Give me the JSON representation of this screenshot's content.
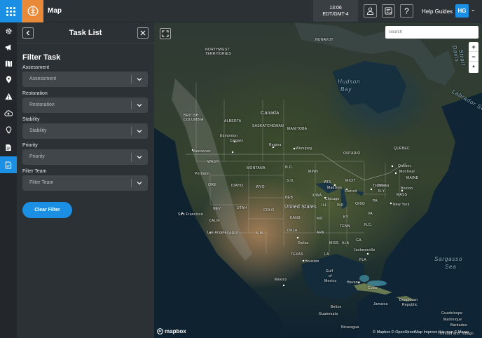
{
  "header": {
    "app_title": "Map",
    "clock_time": "13:06",
    "clock_zone": "EDT/GMT-4",
    "help_label": "Help Guides",
    "avatar_initials": "HG"
  },
  "rail": {
    "icons": [
      "gear-icon",
      "megaphone-icon",
      "map-icon",
      "pin-icon",
      "warning-icon",
      "cloud-upload-icon",
      "bulb-icon",
      "document-icon",
      "task-list-icon"
    ],
    "active_index": 8
  },
  "panel": {
    "title": "Task List",
    "filter_heading": "Filter Task",
    "filters": [
      {
        "label": "Assessment",
        "value": "Assessment"
      },
      {
        "label": "Restoration",
        "value": "Restoration"
      },
      {
        "label": "Stability",
        "value": "Stability"
      },
      {
        "label": "Priority",
        "value": "Priority"
      },
      {
        "label": "Filter Team",
        "value": "Filter Team"
      }
    ],
    "clear_label": "Clear Filter"
  },
  "map": {
    "search_placeholder": "Search",
    "zoom_in": "+",
    "zoom_out": "−",
    "reset_north": "▲",
    "logo_text": "mapbox",
    "attribution": "© Mapbox © OpenStreetMap Improve this map © Maxar",
    "labels": {
      "nwt": "NORTHWEST",
      "nwt2": "TERRITORIES",
      "nunavut": "NUNAVUT",
      "hudson1": "Hudson",
      "hudson2": "Bay",
      "davis1": "Davis",
      "davis2": "Strait",
      "labrador": "Labrador Sea",
      "canada": "Canada",
      "bc1": "BRITISH",
      "bc2": "COLUMBIA",
      "alberta": "ALBERTA",
      "sask": "SASKATCHEWAN",
      "manitoba": "MANITOBA",
      "ontario": "ONTARIO",
      "quebec": "QUÉBEC",
      "edmonton": "Edmonton",
      "calgary": "Calgary",
      "regina": "Regina",
      "winnipeg": "Winnipeg",
      "vancouver": "Vancouver",
      "ottawa": "Ottawa",
      "quebec_city": "Québec",
      "montreal": "Montreal",
      "wash": "WASH",
      "montana": "MONTANA",
      "ore": "ORE",
      "idaho": "IDAHO",
      "nd": "N.D.",
      "sd": "S.D.",
      "minn": "MINN",
      "wis": "WIS",
      "mich": "MICH",
      "maine": "MAINE",
      "portland": "Portland",
      "wyo": "WYO",
      "neb": "NEB",
      "iowa": "IOWA",
      "madison": "Madison",
      "detroit": "Detroit",
      "toronto": "Toronto",
      "ny": "N.Y.",
      "boston": "Boston",
      "mass": "MASS",
      "nev": "NEV",
      "utah": "UTAH",
      "colo": "COLO",
      "ill": "ILL",
      "ind": "IND",
      "ohio": "OHIO",
      "pa": "PA",
      "chicago": "Chicago",
      "newyork": "New York",
      "sanfrancisco": "San Francisco",
      "calif": "CALIF",
      "unitedstates": "United States",
      "kans": "KANS",
      "mo": "MO",
      "ky": "KY",
      "va": "VA",
      "losangeles": "Los Angeles",
      "ariz": "ARIZ",
      "nm": "N.M.",
      "okla": "OKLA",
      "ark": "ARK",
      "tenn": "TENN",
      "nc": "N.C.",
      "texas": "TEXAS",
      "dallas": "Dallas",
      "miss": "MISS",
      "ala": "ALA",
      "ga": "GA",
      "jacksonville": "Jacksonville",
      "houston": "Houston",
      "la": "LA",
      "fla": "FLA",
      "sargasso1": "Sargasso",
      "sargasso2": "Sea",
      "gulf1": "Gulf",
      "gulf2": "of",
      "gulf3": "Mexico",
      "havana": "Havana",
      "cuba": "Cuba",
      "mexico": "Mexico",
      "jamaica": "Jamaica",
      "dominican1": "Dominican",
      "dominican2": "Republic",
      "belize": "Belize",
      "guatemala": "Guatemala",
      "nicaragua": "Nicaragua",
      "guadeloupe": "Guadeloupe",
      "martinique": "Martinique",
      "barbados": "Barbados",
      "trinidad": "Trinidad and Tobago"
    }
  }
}
